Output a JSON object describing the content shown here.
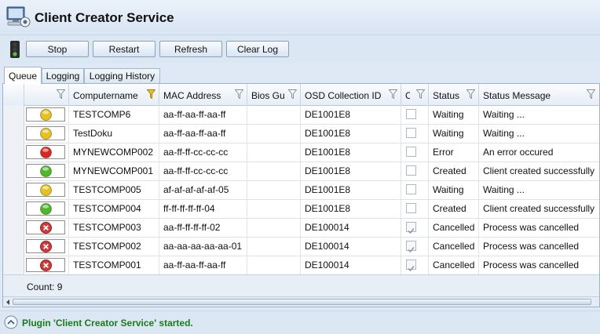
{
  "window": {
    "title": "Client Creator Service"
  },
  "toolbar": {
    "stop": "Stop",
    "restart": "Restart",
    "refresh": "Refresh",
    "clear_log": "Clear Log"
  },
  "tabs": [
    {
      "label": "Queue",
      "active": true
    },
    {
      "label": "Logging",
      "active": false
    },
    {
      "label": "Logging History",
      "active": false
    }
  ],
  "columns": [
    "",
    "Computername",
    "MAC Address",
    "Bios Gu",
    "OSD Collection ID",
    "C",
    "Status",
    "Status Message"
  ],
  "rows": [
    {
      "state": "yellow",
      "name": "TESTCOMP6",
      "mac": "aa-ff-aa-ff-aa-ff",
      "bios": "",
      "osd": "DE1001E8",
      "checked": false,
      "status": "Waiting",
      "message": "Waiting ..."
    },
    {
      "state": "yellow",
      "name": "TestDoku",
      "mac": "aa-ff-aa-ff-aa-ff",
      "bios": "",
      "osd": "DE1001E8",
      "checked": false,
      "status": "Waiting",
      "message": "Waiting ..."
    },
    {
      "state": "red",
      "name": "MYNEWCOMP002",
      "mac": "aa-ff-ff-cc-cc-cc",
      "bios": "",
      "osd": "DE1001E8",
      "checked": false,
      "status": "Error",
      "message": "An error occured"
    },
    {
      "state": "green",
      "name": "MYNEWCOMP001",
      "mac": "aa-ff-ff-cc-cc-cc",
      "bios": "",
      "osd": "DE1001E8",
      "checked": false,
      "status": "Created",
      "message": "Client created successfully"
    },
    {
      "state": "yellow",
      "name": "TESTCOMP005",
      "mac": "af-af-af-af-af-05",
      "bios": "",
      "osd": "DE1001E8",
      "checked": false,
      "status": "Waiting",
      "message": "Waiting ..."
    },
    {
      "state": "green",
      "name": "TESTCOMP004",
      "mac": "ff-ff-ff-ff-ff-04",
      "bios": "",
      "osd": "DE1001E8",
      "checked": false,
      "status": "Created",
      "message": "Client created successfully"
    },
    {
      "state": "cancel",
      "name": "TESTCOMP003",
      "mac": "aa-ff-ff-ff-ff-02",
      "bios": "",
      "osd": "DE100014",
      "checked": true,
      "status": "Cancelled",
      "message": "Process was cancelled"
    },
    {
      "state": "cancel",
      "name": "TESTCOMP002",
      "mac": "aa-aa-aa-aa-aa-01",
      "bios": "",
      "osd": "DE100014",
      "checked": true,
      "status": "Cancelled",
      "message": "Process was cancelled"
    },
    {
      "state": "cancel",
      "name": "TESTCOMP001",
      "mac": "aa-ff-aa-ff-aa-ff",
      "bios": "",
      "osd": "DE100014",
      "checked": true,
      "status": "Cancelled",
      "message": "Process was cancelled"
    }
  ],
  "count_label": "Count: 9",
  "status_bar": {
    "message": "Plugin 'Client Creator Service' started."
  },
  "colors": {
    "yellow": "#e8c21c",
    "red": "#d8281f",
    "green": "#4fb82a",
    "cancel": "#d23a3a",
    "status_text": "#1a7a1a"
  }
}
